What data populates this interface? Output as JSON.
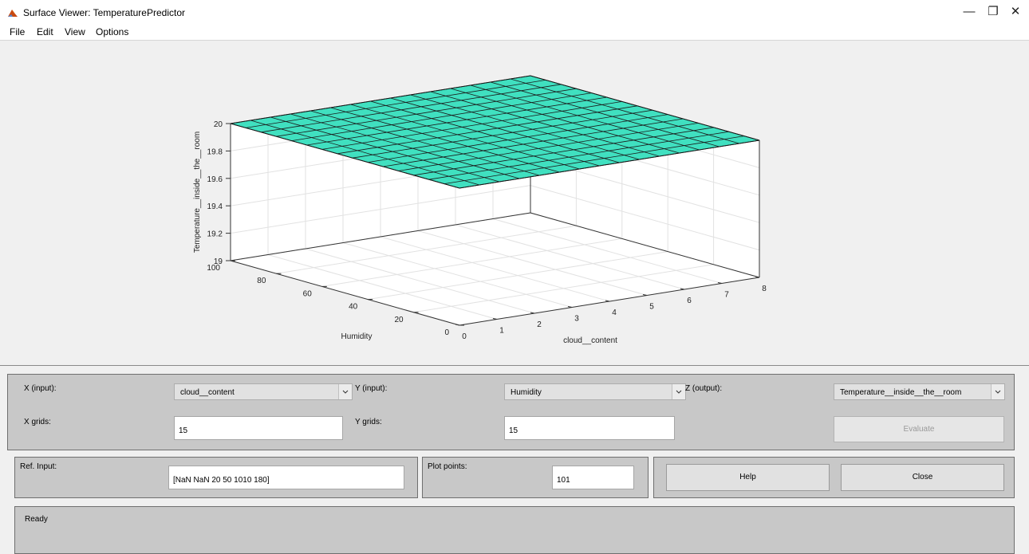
{
  "window": {
    "title": "Surface Viewer: TemperaturePredictor",
    "controls": {
      "minimize": "—",
      "restore": "❐",
      "close": "✕"
    }
  },
  "menu": [
    "File",
    "Edit",
    "View",
    "Options"
  ],
  "chart_data": {
    "type": "surface",
    "xlabel": "cloud__content",
    "ylabel": "Humidity",
    "zlabel": "Temperature__inside__the__room",
    "xlim": [
      0,
      8
    ],
    "ylim": [
      0,
      100
    ],
    "zlim": [
      19,
      20
    ],
    "x_ticks": [
      "0",
      "1",
      "2",
      "3",
      "4",
      "5",
      "6",
      "7",
      "8"
    ],
    "y_ticks": [
      "0",
      "20",
      "40",
      "60",
      "80",
      "100"
    ],
    "z_ticks": [
      "19",
      "19.2",
      "19.4",
      "19.6",
      "19.8",
      "20"
    ],
    "grid": true,
    "surface_value": 20,
    "surface_color": "#40e0c0"
  },
  "controls": {
    "x_input_label": "X (input):",
    "x_input_value": "cloud__content",
    "y_input_label": "Y (input):",
    "y_input_value": "Humidity",
    "z_output_label": "Z (output):",
    "z_output_value": "Temperature__inside__the__room",
    "x_grids_label": "X grids:",
    "x_grids_value": "15",
    "y_grids_label": "Y grids:",
    "y_grids_value": "15",
    "evaluate_label": "Evaluate",
    "ref_input_label": "Ref. Input:",
    "ref_input_value": "[NaN NaN 20 50 1010 180]",
    "plot_points_label": "Plot points:",
    "plot_points_value": "101",
    "help_label": "Help",
    "close_label": "Close",
    "status": "Ready"
  }
}
